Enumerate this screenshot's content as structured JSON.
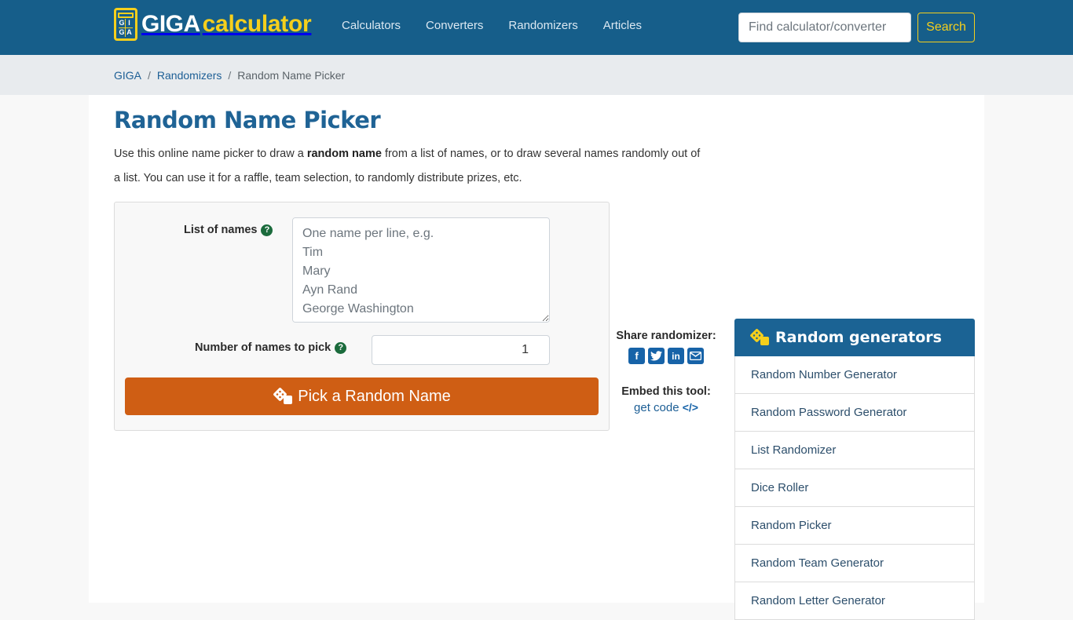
{
  "header": {
    "logo_grid": [
      "G",
      "I",
      "G",
      "A"
    ],
    "logo_part1": "GIGA",
    "logo_part2": "calculator",
    "nav": [
      "Calculators",
      "Converters",
      "Randomizers",
      "Articles"
    ],
    "search_placeholder": "Find calculator/converter",
    "search_button": "Search"
  },
  "breadcrumb": {
    "items": [
      "GIGA",
      "Randomizers"
    ],
    "separator": "/",
    "current": "Random Name Picker"
  },
  "page": {
    "title": "Random Name Picker",
    "intro_part1": "Use this online name picker to draw a ",
    "intro_bold": "random name",
    "intro_part2": " from a list of names, or to draw several names randomly out of a list. You can use it for a raffle, team selection, to randomly distribute prizes, etc."
  },
  "form": {
    "list_label": "List of names",
    "list_placeholder": "One name per line, e.g.\nTim\nMary\nAyn Rand\nGeorge Washington",
    "count_label": "Number of names to pick",
    "count_value": "1",
    "help_glyph": "?",
    "submit_label": "Pick a Random Name"
  },
  "share": {
    "title": "Share randomizer:",
    "icons": [
      "facebook-icon",
      "twitter-icon",
      "linkedin-icon",
      "email-icon"
    ],
    "embed_title": "Embed this tool:",
    "embed_link": "get code",
    "embed_glyph": "</>"
  },
  "sidebar": {
    "title": "Random generators",
    "items": [
      "Random Number Generator",
      "Random Password Generator",
      "List Randomizer",
      "Dice Roller",
      "Random Picker",
      "Random Team Generator",
      "Random Letter Generator"
    ]
  },
  "colors": {
    "header_bg": "#165e8a",
    "accent_yellow": "#f5cf1c",
    "title_blue": "#1f6395",
    "button_orange": "#cf5e14",
    "help_green": "#1b6b3c"
  }
}
